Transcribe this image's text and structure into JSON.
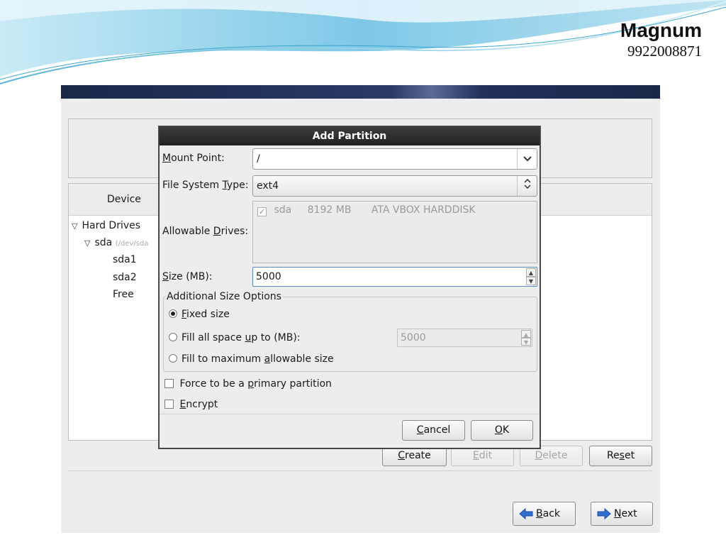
{
  "slide": {
    "brand_name": "Magnum",
    "brand_phone": "9922008871"
  },
  "installer": {
    "device_column": "Device",
    "tree": [
      {
        "label": "Hard Drives",
        "level": 0,
        "expanded": true,
        "sub": ""
      },
      {
        "label": "sda",
        "level": 1,
        "expanded": true,
        "sub": "(/dev/sda"
      },
      {
        "label": "sda1",
        "level": 2,
        "sub": ""
      },
      {
        "label": "sda2",
        "level": 2,
        "sub": ""
      },
      {
        "label": "Free",
        "level": 2,
        "sub": ""
      }
    ],
    "buttons": {
      "create": {
        "pre": "",
        "mn": "C",
        "post": "reate"
      },
      "edit": {
        "pre": "",
        "mn": "E",
        "post": "dit"
      },
      "delete": {
        "pre": "",
        "mn": "D",
        "post": "elete"
      },
      "reset": {
        "pre": "Re",
        "mn": "s",
        "post": "et"
      }
    },
    "back": {
      "pre": "",
      "mn": "B",
      "post": "ack"
    },
    "next": {
      "pre": "",
      "mn": "N",
      "post": "ext"
    }
  },
  "dialog": {
    "title": "Add Partition",
    "mount_point": {
      "pre": "",
      "mn": "M",
      "post": "ount Point:",
      "value": "/"
    },
    "fs_type": {
      "pre": "File System ",
      "mn": "T",
      "post": "ype:",
      "value": "ext4"
    },
    "allowable": {
      "pre": "Allowable ",
      "mn": "D",
      "post": "rives:"
    },
    "drive": {
      "name": "sda",
      "size": "8192 MB",
      "model": "ATA VBOX HARDDISK",
      "checked": true
    },
    "size": {
      "pre": "",
      "mn": "S",
      "post": "ize (MB):",
      "value": "5000"
    },
    "additional_label": "Additional Size Options",
    "fixed": {
      "pre": "",
      "mn": "F",
      "post": "ixed size"
    },
    "fill_upto": {
      "pre": "Fill all space ",
      "mn": "u",
      "post": "p to (MB):",
      "value": "5000"
    },
    "fill_max": {
      "pre": "Fill to maximum ",
      "mn": "a",
      "post": "llowable size"
    },
    "selected_option": "fixed",
    "primary": {
      "pre": "Force to be a ",
      "mn": "p",
      "post": "rimary partition"
    },
    "encrypt": {
      "pre": "",
      "mn": "E",
      "post": "ncrypt"
    },
    "cancel": {
      "pre": "",
      "mn": "C",
      "post": "ancel"
    },
    "ok": {
      "pre": "",
      "mn": "O",
      "post": "K"
    }
  },
  "colors": {
    "banner": "#1b2748",
    "arrow_blue": "#2f6fd0",
    "slide_teal": "#7ec8e6"
  },
  "icons": {
    "back": "arrow-left-icon",
    "next": "arrow-right-icon",
    "combo": "chevron-down-icon",
    "spin": "spin-arrows-icon"
  }
}
